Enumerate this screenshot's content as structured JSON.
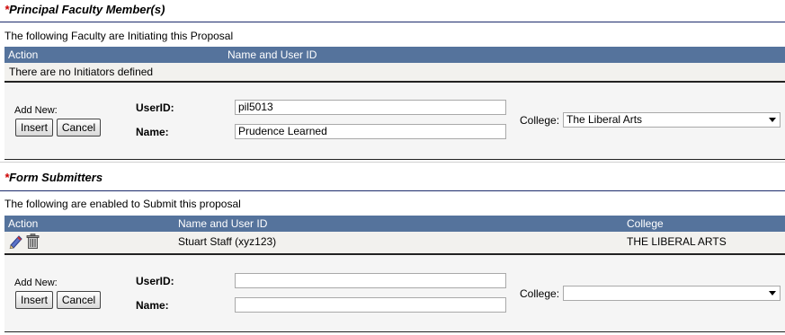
{
  "principal": {
    "required_mark": "*",
    "title": "Principal Faculty Member(s)",
    "description": "The following Faculty are Initiating this Proposal",
    "columns": {
      "action": "Action",
      "name": "Name and User ID"
    },
    "empty_text": "There are no Initiators defined",
    "add": {
      "add_new_label": "Add New:",
      "insert_label": "Insert",
      "cancel_label": "Cancel",
      "userid_label": "UserID:",
      "userid_value": "pil5013",
      "name_label": "Name:",
      "name_value": "Prudence Learned",
      "college_label": "College:",
      "college_value": "The Liberal Arts"
    }
  },
  "submitters": {
    "required_mark": "*",
    "title": "Form Submitters",
    "description": "The following are enabled to Submit this proposal",
    "columns": {
      "action": "Action",
      "name": "Name and User ID",
      "college": "College"
    },
    "rows": [
      {
        "name": "Stuart Staff (xyz123)",
        "college": "THE LIBERAL ARTS",
        "edit_icon": "pencil-icon",
        "delete_icon": "trash-icon"
      }
    ],
    "add": {
      "add_new_label": "Add New:",
      "insert_label": "Insert",
      "cancel_label": "Cancel",
      "userid_label": "UserID:",
      "userid_value": "",
      "name_label": "Name:",
      "name_value": "",
      "college_label": "College:",
      "college_value": ""
    }
  },
  "colors": {
    "header_bar": "#55739c",
    "divider": "#1c2a6b",
    "required": "#cc0000"
  }
}
